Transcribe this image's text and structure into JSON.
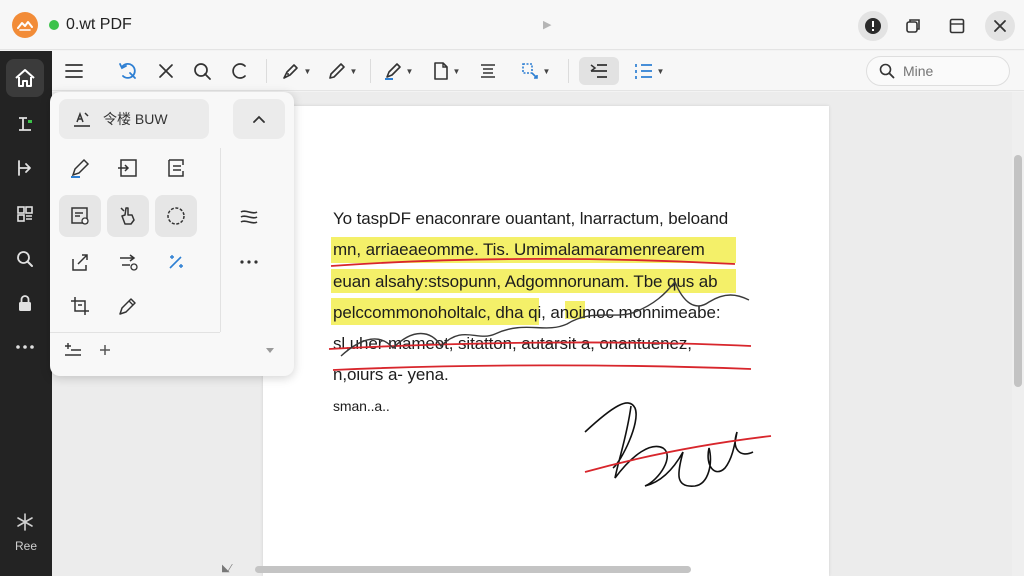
{
  "titlebar": {
    "title": "0.wt PDF"
  },
  "rail": {
    "bottom_label": "Ree"
  },
  "search": {
    "placeholder": "Mine"
  },
  "panel": {
    "header_label": "令楼 BUW"
  },
  "document": {
    "lines": [
      "Yo taspDF enaconrare ouantant, lnarractum, beloand",
      "mn, arriaeaeomme. Tis. Umimalamaramenrearem",
      "euan alsahy:stsopunn, Adgomnorunam. Tbe qus ab",
      "pelccommonoholtalc, dha qi, anoimoc monnimeabe:",
      "sl,uher mameot, sitatton, autarsit a, onantuenez,",
      "n,oiurs a- yena.",
      "sman..a.."
    ]
  },
  "colors": {
    "accent": "#f28c38",
    "highlight": "#f4f069",
    "ink_red": "#d8262c",
    "rail_bg": "#232323"
  }
}
